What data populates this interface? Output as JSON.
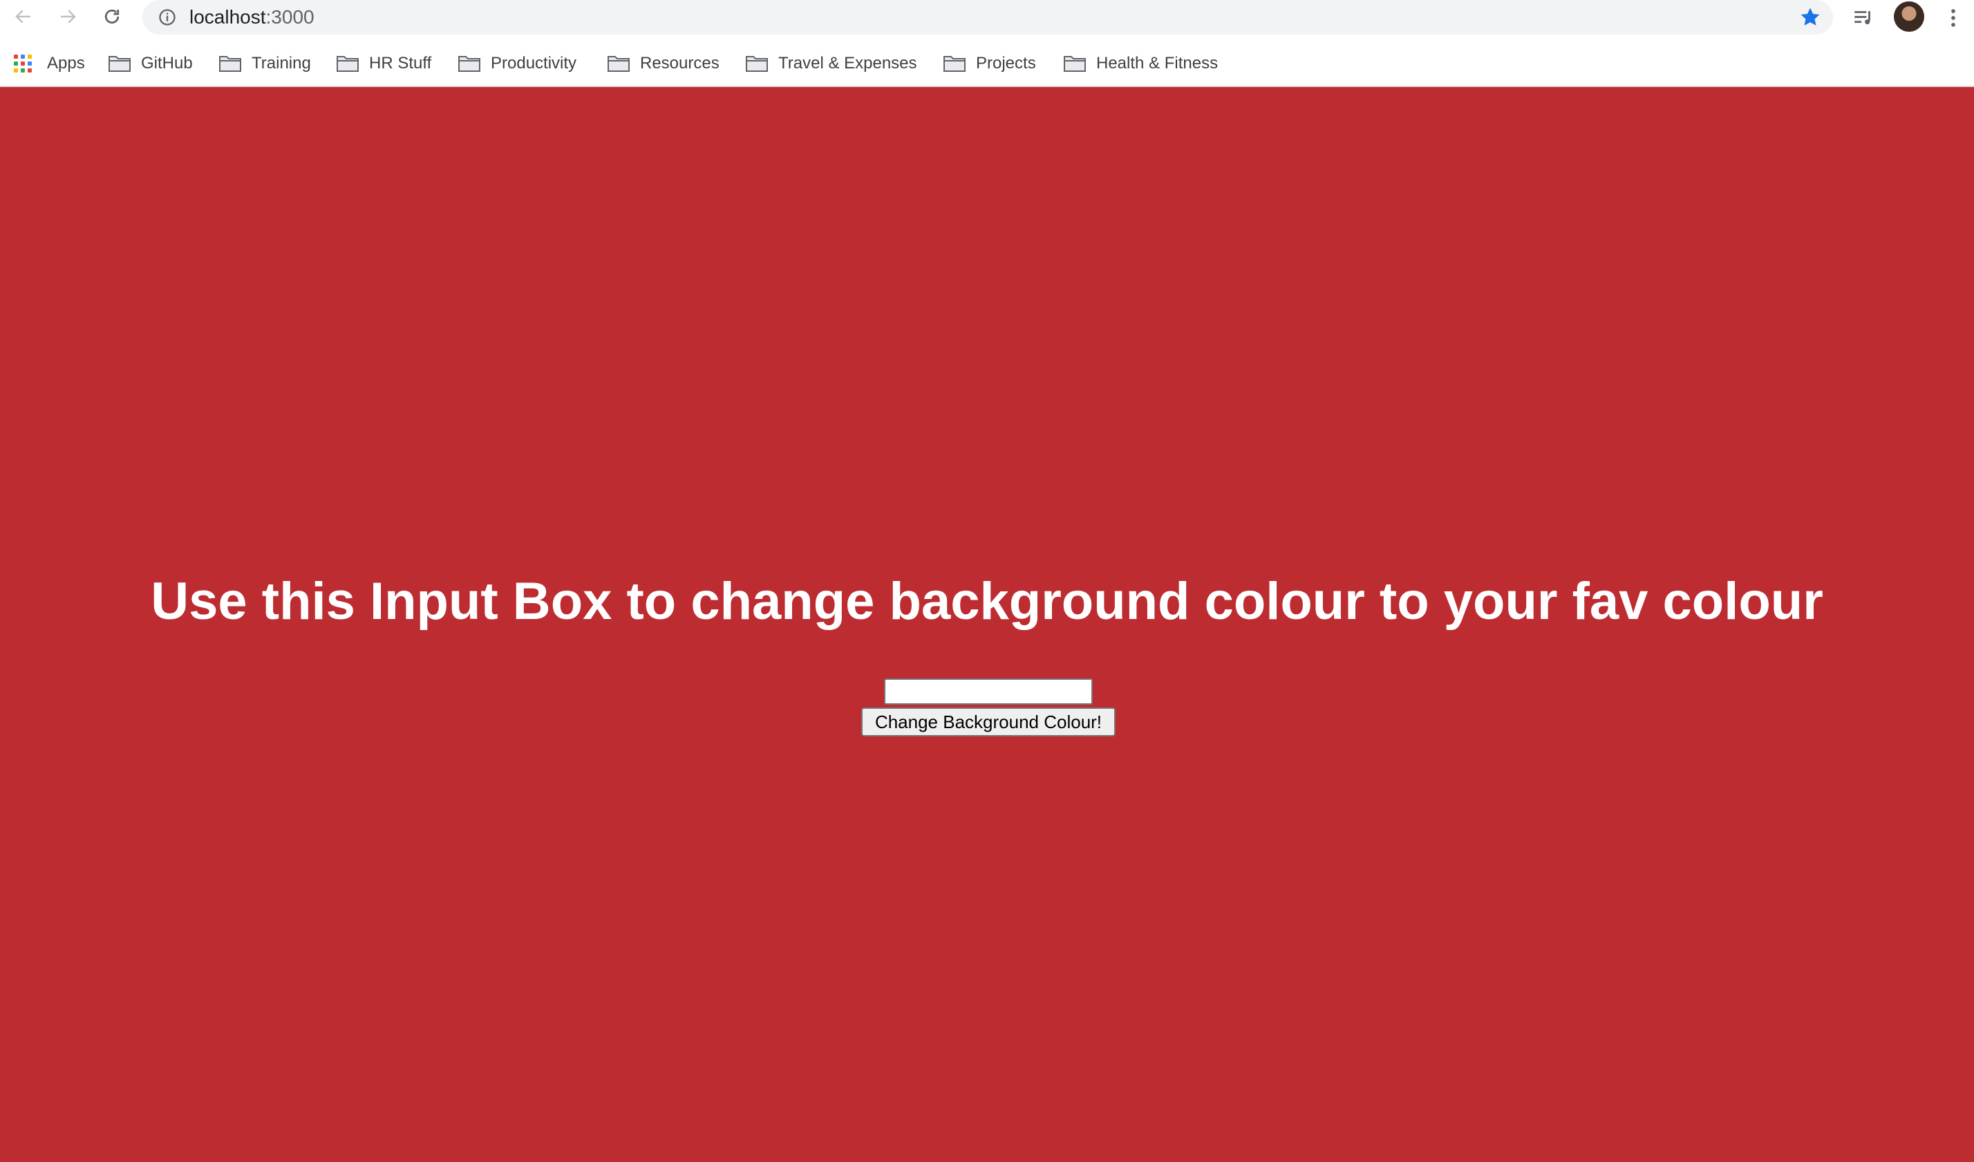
{
  "browser": {
    "url_host": "localhost",
    "url_port": ":3000",
    "bookmarks": [
      {
        "label": "Apps",
        "icon": "apps-grid-icon"
      },
      {
        "label": "GitHub",
        "icon": "folder-icon"
      },
      {
        "label": "Training",
        "icon": "folder-icon"
      },
      {
        "label": "HR Stuff",
        "icon": "folder-icon"
      },
      {
        "label": "Productivity",
        "icon": "folder-icon"
      },
      {
        "label": "Resources",
        "icon": "folder-icon"
      },
      {
        "label": "Travel & Expenses",
        "icon": "folder-icon"
      },
      {
        "label": "Projects",
        "icon": "folder-icon"
      },
      {
        "label": "Health & Fitness",
        "icon": "folder-icon"
      }
    ],
    "colors": {
      "toolbar_bg": "#ffffff",
      "omnibox_bg": "#f1f3f4",
      "star": "#1a73e8"
    }
  },
  "page": {
    "background_color": "#bd2c31",
    "heading": "Use this Input Box to change background colour to your fav colour",
    "input": {
      "value": "",
      "placeholder": ""
    },
    "button_label": "Change Background Colour!"
  }
}
